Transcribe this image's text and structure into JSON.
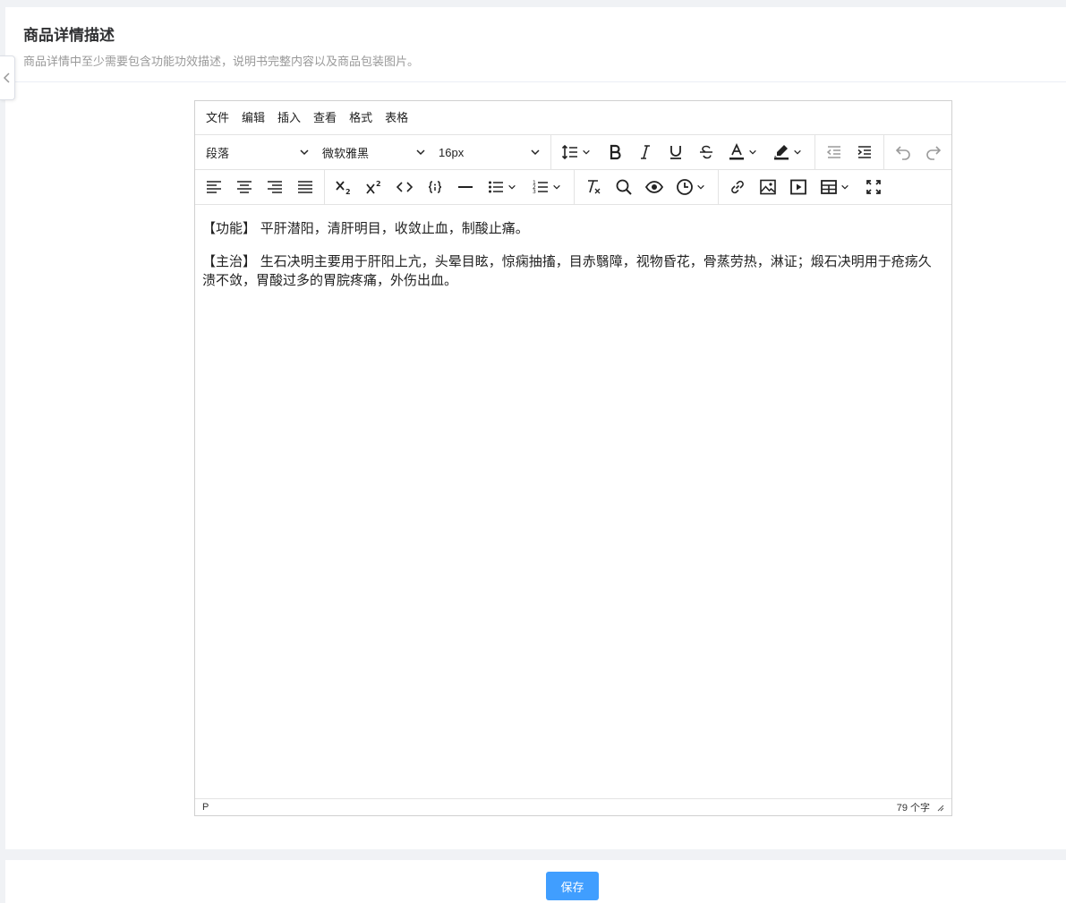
{
  "header": {
    "title": "商品详情描述",
    "subtitle": "商品详情中至少需要包含功能功效描述，说明书完整内容以及商品包装图片。"
  },
  "editor": {
    "menubar": [
      "文件",
      "编辑",
      "插入",
      "查看",
      "格式",
      "表格"
    ],
    "block_format": "段落",
    "font_family": "微软雅黑",
    "font_size": "16px",
    "content": {
      "paragraph_1": "【功能】 平肝潜阳，清肝明目，收敛止血，制酸止痛。",
      "paragraph_2": "【主治】 生石决明主要用于肝阳上亢，头晕目眩，惊痫抽搐，目赤翳障，视物昏花，骨蒸劳热，淋证；煅石决明用于疮疡久溃不敛，胃酸过多的胃脘疼痛，外伤出血。"
    },
    "statusbar": {
      "path": "P",
      "word_count": "79 个字"
    }
  },
  "footer": {
    "save_label": "保存"
  },
  "colors": {
    "primary": "#409eff",
    "border": "#d0d0d0"
  }
}
